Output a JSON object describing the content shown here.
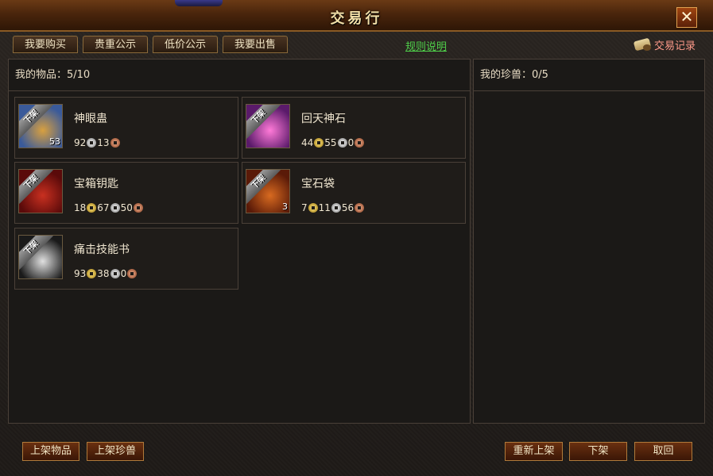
{
  "window": {
    "title": "交易行",
    "close_symbol": "✕"
  },
  "tabs": [
    {
      "label": "我要购买"
    },
    {
      "label": "贵重公示"
    },
    {
      "label": "低价公示"
    },
    {
      "label": "我要出售"
    }
  ],
  "rules_link": "规则说明",
  "trade_record": {
    "label": "交易记录",
    "icon": "scroll-icon"
  },
  "left_panel": {
    "header": "我的物品：5/10"
  },
  "right_panel": {
    "header": "我的珍兽：0/5"
  },
  "ribbon_text": "下架",
  "items": [
    {
      "name": "神眼蛊",
      "qty": "53",
      "price": [
        {
          "v": "92",
          "c": "silver"
        },
        {
          "v": "13",
          "c": "copper"
        }
      ],
      "colors": [
        "#3a5a9a",
        "#d8a040"
      ]
    },
    {
      "name": "回天神石",
      "qty": "",
      "price": [
        {
          "v": "44",
          "c": "gold"
        },
        {
          "v": "55",
          "c": "silver"
        },
        {
          "v": "0",
          "c": "copper"
        }
      ],
      "colors": [
        "#5a1a6a",
        "#ff7ad8"
      ]
    },
    {
      "name": "宝箱钥匙",
      "qty": "",
      "price": [
        {
          "v": "18",
          "c": "gold"
        },
        {
          "v": "67",
          "c": "silver"
        },
        {
          "v": "50",
          "c": "copper"
        }
      ],
      "colors": [
        "#5a0a0a",
        "#c83020"
      ]
    },
    {
      "name": "宝石袋",
      "qty": "3",
      "price": [
        {
          "v": "7",
          "c": "gold"
        },
        {
          "v": "11",
          "c": "silver"
        },
        {
          "v": "56",
          "c": "copper"
        }
      ],
      "colors": [
        "#5a1a08",
        "#d86a20"
      ]
    },
    {
      "name": "痛击技能书",
      "qty": "",
      "price": [
        {
          "v": "93",
          "c": "gold"
        },
        {
          "v": "38",
          "c": "silver"
        },
        {
          "v": "0",
          "c": "copper"
        }
      ],
      "colors": [
        "#1a1a1a",
        "#e0e0e0"
      ]
    }
  ],
  "buttons": {
    "list_item": "上架物品",
    "list_pet": "上架珍兽",
    "relist": "重新上架",
    "delist": "下架",
    "retrieve": "取回"
  }
}
